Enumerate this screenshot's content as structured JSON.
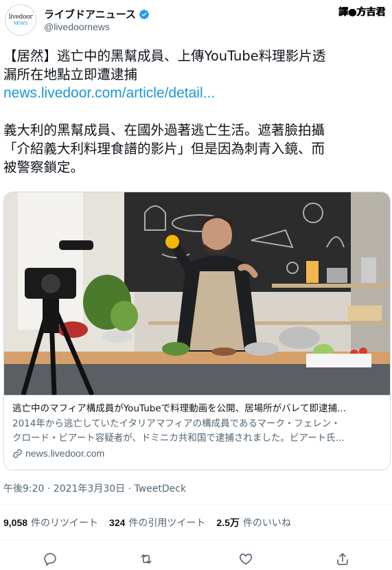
{
  "account": {
    "logo_top": "livedoor",
    "logo_bottom": "NEWS",
    "display_name": "ライブドアニュース",
    "handle": "@livedoornews",
    "verified": true
  },
  "watermark": "譯●方吉君",
  "tweet": {
    "line1": "【居然】逃亡中的黑幫成員、上傳YouTube料理影片透",
    "line2": "漏所在地點立即遭逮捕",
    "link": "news.livedoor.com/article/detail...",
    "body_line1": "義大利的黑幫成員、在國外過著逃亡生活。遮著臉拍攝",
    "body_line2": "「介紹義大利料理食譜的影片」但是因為刺青入鏡、而",
    "body_line3": "被警察鎖定。"
  },
  "card": {
    "title": "逃亡中のマフィア構成員がYouTubeで料理動画を公開、居場所がバレて即逮捕...",
    "desc_line1": "2014年から逃亡していたイタリアマフィアの構成員であるマーク・フェレン・",
    "desc_line2": "クロード・ビアート容疑者が、ドミニカ共和国で逮捕されました。ビアート氏...",
    "domain": "news.livedoor.com",
    "image_alt_icon": "chef-cooking-photo"
  },
  "meta": {
    "timestamp": "午後9:20 · 2021年3月30日 · TweetDeck"
  },
  "stats": {
    "retweets_count": "9,058",
    "retweets_label": "件のリツイート",
    "quotes_count": "324",
    "quotes_label": "件の引用ツイート",
    "likes_count": "2.5万",
    "likes_label": "件のいいね"
  },
  "actions": {
    "reply_icon": "reply-icon",
    "retweet_icon": "retweet-icon",
    "like_icon": "heart-icon",
    "share_icon": "share-icon"
  },
  "colors": {
    "link": "#1b95e0",
    "verified": "#1d9bf0",
    "secondary_text": "#536471",
    "border": "#cfd9de"
  }
}
